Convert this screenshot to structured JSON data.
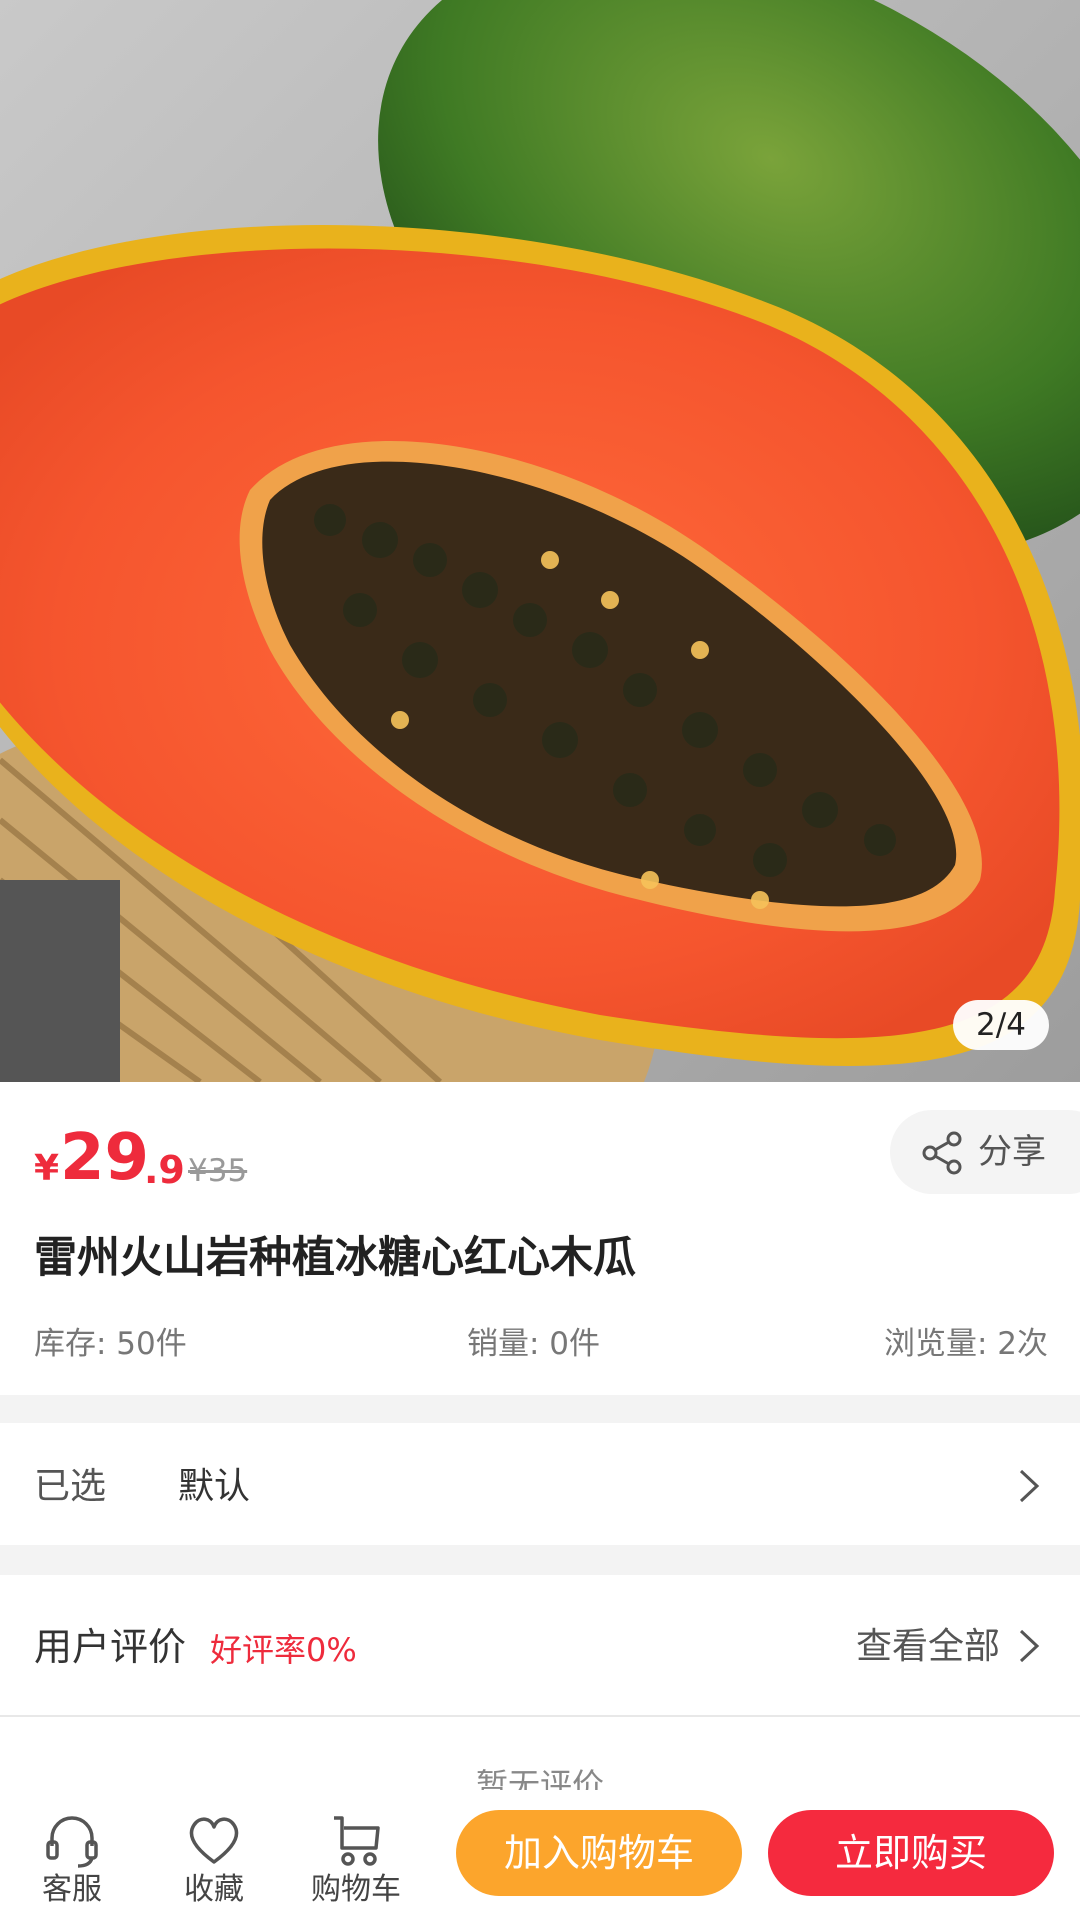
{
  "gallery": {
    "page_indicator": "2/4"
  },
  "price": {
    "currency": "¥",
    "integer": "29",
    "decimal": ".9",
    "original": "¥35"
  },
  "share": {
    "label": "分享"
  },
  "product": {
    "title": "雷州火山岩种植冰糖心红心木瓜"
  },
  "stats": {
    "stock": "库存: 50件",
    "sales": "销量: 0件",
    "views": "浏览量: 2次"
  },
  "selection": {
    "label": "已选",
    "value": "默认"
  },
  "reviews": {
    "title": "用户评价",
    "rate": "好评率0%",
    "view_all": "查看全部",
    "empty": "暂无评价"
  },
  "bottom_bar": {
    "service": "客服",
    "favorite": "收藏",
    "cart": "购物车",
    "add_to_cart": "加入购物车",
    "buy_now": "立即购买"
  },
  "colors": {
    "accent_red": "#ee2b3c",
    "cart_orange": "#fca52c",
    "buy_red": "#f52a3e"
  },
  "icons": [
    "share-icon",
    "chevron-right-icon",
    "headset-icon",
    "heart-icon",
    "cart-icon"
  ]
}
